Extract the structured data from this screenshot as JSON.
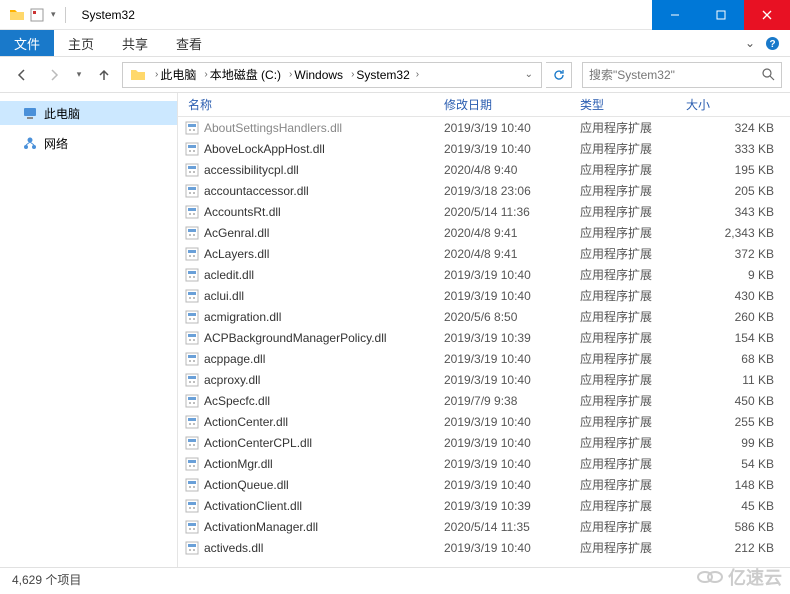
{
  "window": {
    "title": "System32"
  },
  "ribbon": {
    "file": "文件",
    "tabs": [
      "主页",
      "共享",
      "查看"
    ]
  },
  "breadcrumb": {
    "items": [
      "此电脑",
      "本地磁盘 (C:)",
      "Windows",
      "System32"
    ]
  },
  "search": {
    "placeholder": "搜索\"System32\""
  },
  "sidebar": {
    "items": [
      {
        "label": "此电脑",
        "icon": "pc",
        "selected": true
      },
      {
        "label": "网络",
        "icon": "network",
        "selected": false
      }
    ]
  },
  "columns": {
    "name": "名称",
    "date": "修改日期",
    "type": "类型",
    "size": "大小"
  },
  "files": [
    {
      "name": "AboutSettingsHandlers.dll",
      "date": "2019/3/19 10:40",
      "type": "应用程序扩展",
      "size": "324 KB",
      "cut": true
    },
    {
      "name": "AboveLockAppHost.dll",
      "date": "2019/3/19 10:40",
      "type": "应用程序扩展",
      "size": "333 KB"
    },
    {
      "name": "accessibilitycpl.dll",
      "date": "2020/4/8 9:40",
      "type": "应用程序扩展",
      "size": "195 KB"
    },
    {
      "name": "accountaccessor.dll",
      "date": "2019/3/18 23:06",
      "type": "应用程序扩展",
      "size": "205 KB"
    },
    {
      "name": "AccountsRt.dll",
      "date": "2020/5/14 11:36",
      "type": "应用程序扩展",
      "size": "343 KB"
    },
    {
      "name": "AcGenral.dll",
      "date": "2020/4/8 9:41",
      "type": "应用程序扩展",
      "size": "2,343 KB"
    },
    {
      "name": "AcLayers.dll",
      "date": "2020/4/8 9:41",
      "type": "应用程序扩展",
      "size": "372 KB"
    },
    {
      "name": "acledit.dll",
      "date": "2019/3/19 10:40",
      "type": "应用程序扩展",
      "size": "9 KB"
    },
    {
      "name": "aclui.dll",
      "date": "2019/3/19 10:40",
      "type": "应用程序扩展",
      "size": "430 KB"
    },
    {
      "name": "acmigration.dll",
      "date": "2020/5/6 8:50",
      "type": "应用程序扩展",
      "size": "260 KB"
    },
    {
      "name": "ACPBackgroundManagerPolicy.dll",
      "date": "2019/3/19 10:39",
      "type": "应用程序扩展",
      "size": "154 KB"
    },
    {
      "name": "acppage.dll",
      "date": "2019/3/19 10:40",
      "type": "应用程序扩展",
      "size": "68 KB"
    },
    {
      "name": "acproxy.dll",
      "date": "2019/3/19 10:40",
      "type": "应用程序扩展",
      "size": "11 KB"
    },
    {
      "name": "AcSpecfc.dll",
      "date": "2019/7/9 9:38",
      "type": "应用程序扩展",
      "size": "450 KB"
    },
    {
      "name": "ActionCenter.dll",
      "date": "2019/3/19 10:40",
      "type": "应用程序扩展",
      "size": "255 KB"
    },
    {
      "name": "ActionCenterCPL.dll",
      "date": "2019/3/19 10:40",
      "type": "应用程序扩展",
      "size": "99 KB"
    },
    {
      "name": "ActionMgr.dll",
      "date": "2019/3/19 10:40",
      "type": "应用程序扩展",
      "size": "54 KB"
    },
    {
      "name": "ActionQueue.dll",
      "date": "2019/3/19 10:40",
      "type": "应用程序扩展",
      "size": "148 KB"
    },
    {
      "name": "ActivationClient.dll",
      "date": "2019/3/19 10:39",
      "type": "应用程序扩展",
      "size": "45 KB"
    },
    {
      "name": "ActivationManager.dll",
      "date": "2020/5/14 11:35",
      "type": "应用程序扩展",
      "size": "586 KB"
    },
    {
      "name": "activeds.dll",
      "date": "2019/3/19 10:40",
      "type": "应用程序扩展",
      "size": "212 KB"
    }
  ],
  "status": {
    "count": "4,629 个项目"
  },
  "watermark": "亿速云"
}
